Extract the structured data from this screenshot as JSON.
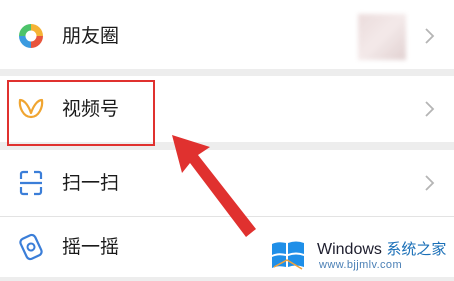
{
  "menu": {
    "items": [
      {
        "label": "朋友圈",
        "icon": "moments-icon"
      },
      {
        "label": "视频号",
        "icon": "channels-icon"
      },
      {
        "label": "扫一扫",
        "icon": "scan-icon"
      },
      {
        "label": "摇一摇",
        "icon": "shake-icon"
      }
    ]
  },
  "annotation": {
    "highlight_color": "#e0312f"
  },
  "watermark": {
    "brand": "Windows",
    "brand_cn": "系统之家",
    "url": "www.bjjmlv.com"
  }
}
